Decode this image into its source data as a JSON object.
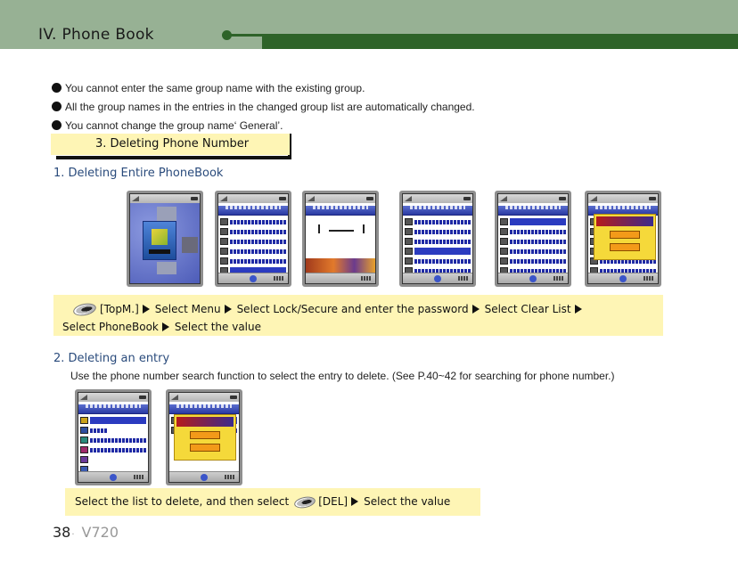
{
  "header": {
    "title": "IV. Phone Book",
    "colors": {
      "band": "#97b194",
      "bar": "#2e6329"
    }
  },
  "bullets": [
    "You cannot enter the same group name with the existing group.",
    "All the group names in the entries in the changed group list are automatically changed.",
    "You cannot change the group name‘ General’."
  ],
  "section": {
    "title": "3. Deleting Phone Number",
    "box_color": "#fef5b5"
  },
  "subsection1": {
    "heading": "1. Deleting Entire PhoneBook",
    "screens": [
      {
        "name": "phone-menu-screen"
      },
      {
        "name": "phone-menu-list-screen"
      },
      {
        "name": "phone-password-screen"
      },
      {
        "name": "phone-lock-menu-screen"
      },
      {
        "name": "phone-clear-list-screen"
      },
      {
        "name": "phone-confirm-popup-screen"
      }
    ],
    "instruction": {
      "key_label": "[TopM.]",
      "steps": [
        "Select Menu",
        "Select Lock/Secure and enter the password",
        "Select Clear List",
        "Select PhoneBook",
        "Select the value"
      ]
    }
  },
  "subsection2": {
    "heading": "2. Deleting an entry",
    "description": "Use the phone number search function to select the entry to delete. (See P.40~42 for searching for phone number.)",
    "screens": [
      {
        "name": "phone-entry-detail-screen"
      },
      {
        "name": "phone-delete-confirm-screen"
      }
    ],
    "instruction": {
      "prefix": "Select the list to delete, and then select",
      "key_label": "[DEL]",
      "steps": [
        "Select the value"
      ]
    }
  },
  "footer": {
    "page": "38",
    "separator": "·",
    "model": "V720"
  }
}
